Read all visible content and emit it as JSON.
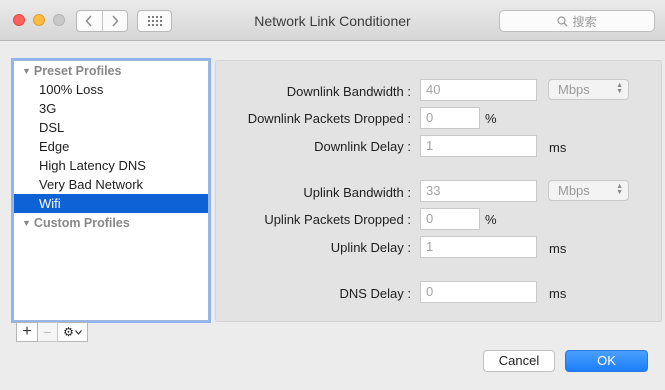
{
  "window": {
    "title": "Network Link Conditioner",
    "search_placeholder": "搜索"
  },
  "sidebar": {
    "preset_header": "Preset Profiles",
    "custom_header": "Custom Profiles",
    "presets": [
      {
        "label": "100% Loss"
      },
      {
        "label": "3G"
      },
      {
        "label": "DSL"
      },
      {
        "label": "Edge"
      },
      {
        "label": "High Latency DNS"
      },
      {
        "label": "Very Bad Network"
      },
      {
        "label": "Wifi",
        "selected": true
      }
    ],
    "toolbar": {
      "add": "+",
      "remove": "−",
      "gear": "⚙"
    }
  },
  "settings": {
    "downlink_bandwidth": {
      "label": "Downlink Bandwidth :",
      "value": "40",
      "unit": "Mbps"
    },
    "downlink_packets_dropped": {
      "label": "Downlink Packets Dropped :",
      "value": "0",
      "unit": "%"
    },
    "downlink_delay": {
      "label": "Downlink Delay :",
      "value": "1",
      "unit": "ms"
    },
    "uplink_bandwidth": {
      "label": "Uplink Bandwidth :",
      "value": "33",
      "unit": "Mbps"
    },
    "uplink_packets_dropped": {
      "label": "Uplink Packets Dropped :",
      "value": "0",
      "unit": "%"
    },
    "uplink_delay": {
      "label": "Uplink Delay :",
      "value": "1",
      "unit": "ms"
    },
    "dns_delay": {
      "label": "DNS Delay :",
      "value": "0",
      "unit": "ms"
    }
  },
  "buttons": {
    "cancel": "Cancel",
    "ok": "OK"
  },
  "colors": {
    "selection": "#0f62d6",
    "ok_button": "#1b7df7",
    "focus_ring": "#8fb3ec"
  }
}
